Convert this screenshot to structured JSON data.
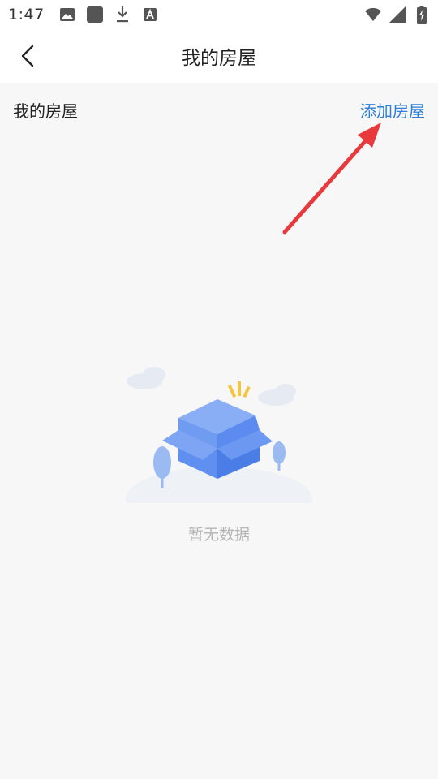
{
  "status_bar": {
    "time": "1:47",
    "left_icons": [
      "image-icon",
      "square-app-icon",
      "download-icon",
      "font-a-icon"
    ],
    "right_icons": [
      "wifi-icon",
      "signal-icon",
      "battery-charging-icon"
    ]
  },
  "nav": {
    "back_icon": "chevron-left-icon",
    "title": "我的房屋"
  },
  "section": {
    "title": "我的房屋",
    "add_link": "添加房屋"
  },
  "empty_state": {
    "icon": "open-box-icon",
    "text": "暂无数据"
  },
  "colors": {
    "link_blue": "#2f7fd8",
    "annotation_red": "#e8393c",
    "box_blue": "#6f9cf0",
    "background": "#f7f7f7"
  }
}
